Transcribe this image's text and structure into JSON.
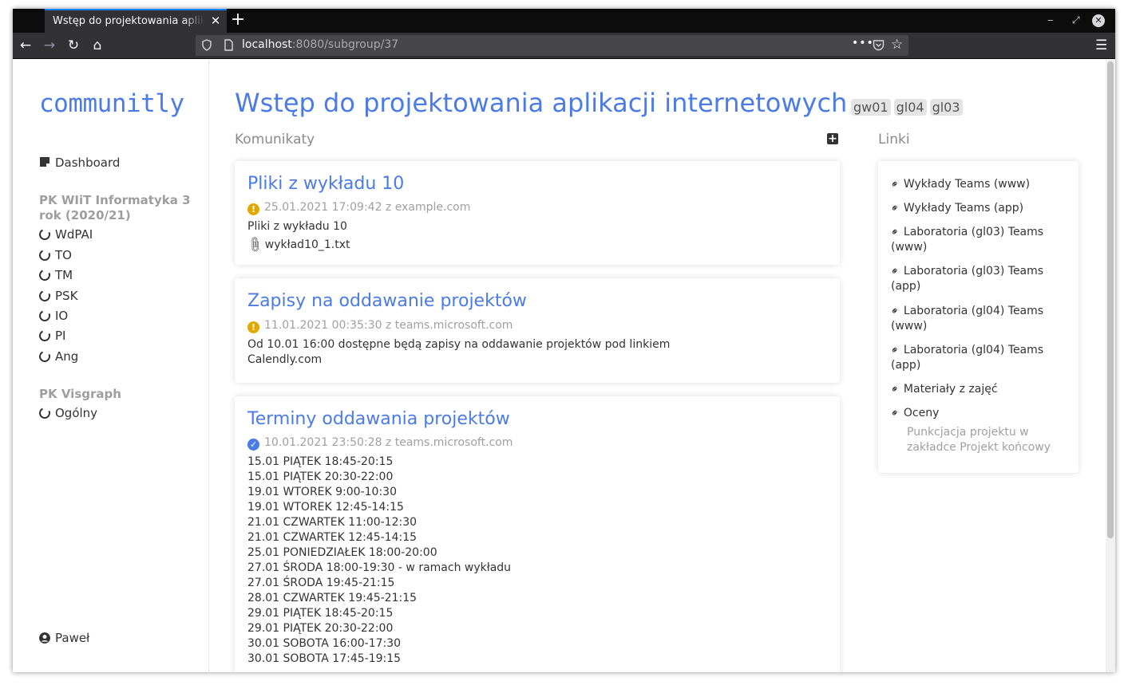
{
  "browser": {
    "tab_title": "Wstęp do projektowania aplikacji internetowych",
    "tab_close": "✕",
    "new_tab": "+",
    "url_host": "localhost",
    "url_rest": ":8080/subgroup/37",
    "url_more": "•••"
  },
  "sidebar": {
    "logo": "communitly",
    "dashboard": "Dashboard",
    "groups": [
      {
        "name": "PK WIiT Informatyka 3 rok (2020/21)",
        "items": [
          "WdPAI",
          "TO",
          "TM",
          "PSK",
          "IO",
          "PI",
          "Ang"
        ]
      },
      {
        "name": "PK Visgraph",
        "items": [
          "Ogólny"
        ]
      }
    ],
    "user": "Paweł"
  },
  "main": {
    "title": "Wstęp do projektowania aplikacji internetowych",
    "tags": [
      "gw01",
      "gl04",
      "gl03"
    ],
    "announcements_header": "Komunikaty",
    "links_header": "Linki",
    "cards": [
      {
        "title": "Pliki z wykładu 10",
        "meta": "25.01.2021 17:09:42 z example.com",
        "status": "warning",
        "body": [
          "Pliki z wykładu 10"
        ],
        "attachment": "wykład10_1.txt"
      },
      {
        "title": "Zapisy na oddawanie projektów",
        "meta": "11.01.2021 00:35:30 z teams.microsoft.com",
        "status": "warning",
        "body": [
          "Od 10.01 16:00 dostępne będą zapisy na oddawanie projektów pod linkiem",
          "Calendly.com"
        ]
      },
      {
        "title": "Terminy oddawania projektów",
        "meta": "10.01.2021 23:50:28 z teams.microsoft.com",
        "status": "confirmed",
        "body": [
          "15.01 PIĄTEK 18:45-20:15",
          "15.01 PIĄTEK 20:30-22:00",
          "19.01 WTOREK 9:00-10:30",
          "19.01 WTOREK 12:45-14:15",
          "21.01 CZWARTEK 11:00-12:30",
          "21.01 CZWARTEK 12:45-14:15",
          "25.01 PONIEDZIAŁEK 18:00-20:00",
          "27.01 ŚRODA 18:00-19:30 - w ramach wykładu",
          "27.01 ŚRODA 19:45-21:15",
          "28.01 CZWARTEK 19:45-21:15",
          "29.01 PIĄTEK 18:45-20:15",
          "29.01 PIĄTEK 20:30-22:00",
          "30.01 SOBOTA 16:00-17:30",
          "30.01 SOBOTA 17:45-19:15"
        ]
      }
    ],
    "links": [
      "Wykłady Teams (www)",
      "Wykłady Teams (app)",
      "Laboratoria (gl03) Teams (www)",
      "Laboratoria (gl03) Teams (app)",
      "Laboratoria (gl04) Teams (www)",
      "Laboratoria (gl04) Teams (app)",
      "Materiały z zajęć",
      "Oceny"
    ],
    "links_note": "Punkcjacja projektu w zakładce Projekt końcowy"
  },
  "colors": {
    "accent": "#4b7be5",
    "warning": "#e0a800",
    "muted": "#a0a0a0"
  }
}
